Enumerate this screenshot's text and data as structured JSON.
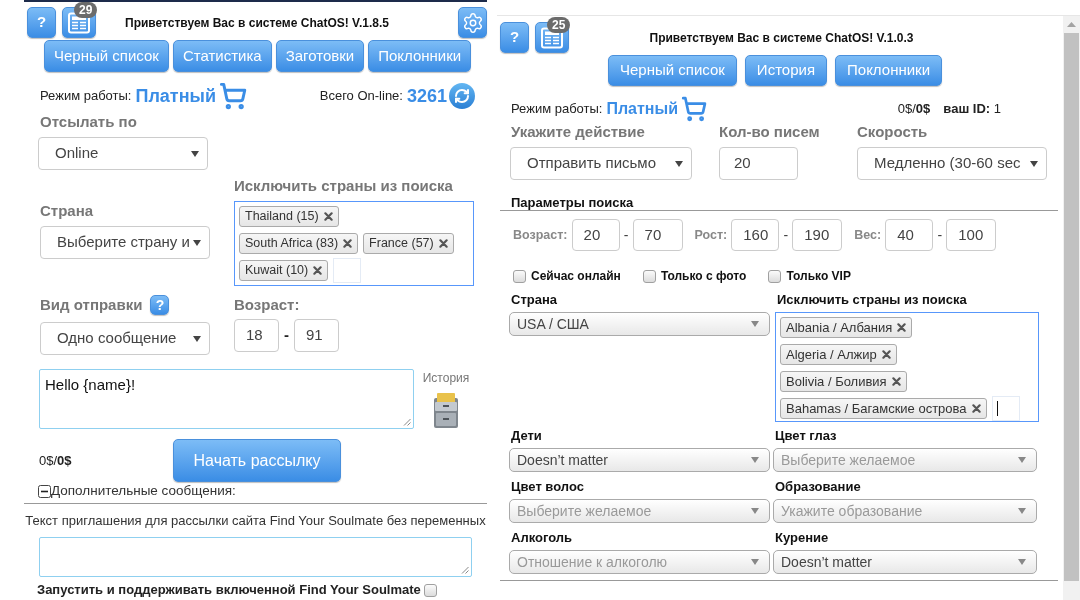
{
  "left_panel": {
    "header": {
      "help": "?",
      "news_count": "29",
      "title": "Приветствуем Вас в системе ChatOS! V.1.8.5"
    },
    "nav_buttons": [
      "Черный список",
      "Статистика",
      "Заготовки",
      "Поклонники"
    ],
    "mode": {
      "label": "Режим работы:",
      "value": "Платный"
    },
    "online": {
      "label": "Всего On-line:",
      "value": "3261"
    },
    "send_by": {
      "label": "Отсылать по",
      "value": "Online"
    },
    "exclude_countries": {
      "label": "Исключить страны из поиска",
      "tag_rows": [
        [
          "Thailand (15)"
        ],
        [
          "South Africa (83)",
          "France (57)"
        ],
        [
          "Kuwait (10)"
        ]
      ]
    },
    "country": {
      "label": "Страна",
      "value": "Выберите страну и"
    },
    "send_type": {
      "label": "Вид отправки",
      "help": "?",
      "value": "Одно сообщение"
    },
    "age": {
      "label": "Возраст:",
      "from": "18",
      "separator": "-",
      "to": "91"
    },
    "message": {
      "value": "Hello {name}!"
    },
    "history": {
      "label": "История"
    },
    "balance": "0$/**0$**",
    "start_button": "Начать рассылку",
    "extra_messages": {
      "label": "Дополнительные сообщения:",
      "expanded": true
    },
    "invite": {
      "label": "Текст приглашения для рассылки сайта Find Your Soulmate без переменных"
    },
    "keep_running": {
      "label": "Запустить и поддерживать включенной Find Your Soulmate",
      "checked": false
    }
  },
  "right_panel": {
    "header": {
      "help": "?",
      "news_count": "25",
      "title": "Приветствуем Вас в системе ChatOS! V.1.0.3"
    },
    "nav_buttons": [
      "Черный список",
      "История",
      "Поклонники"
    ],
    "mode": {
      "label": "Режим работы:",
      "value": "Платный"
    },
    "balance": "0$/**0$**",
    "user_id": "**ваш ID:** 1",
    "action": {
      "label": "Укажите действие",
      "value": "Отправить письмо"
    },
    "letter_count": {
      "label": "Кол-во писем",
      "value": "20"
    },
    "speed": {
      "label": "Скорость",
      "value": "Медленно (30-60 sec"
    },
    "search_params": {
      "title": "Параметры поиска",
      "ranges": [
        {
          "label": "Возраст:",
          "from": "20",
          "separator": "-",
          "to": "70"
        },
        {
          "label": "Рост:",
          "from": "160",
          "separator": "-",
          "to": "190"
        },
        {
          "label": "Вес:",
          "from": "40",
          "separator": "-",
          "to": "100"
        }
      ],
      "filters": [
        {
          "label": "Сейчас онлайн",
          "checked": false
        },
        {
          "label": "Только с фото",
          "checked": false
        },
        {
          "label": "Только VIP",
          "checked": false
        }
      ]
    },
    "country": {
      "label": "Страна",
      "value": "USA / США"
    },
    "exclude_countries": {
      "label": "Исключить страны из поиска",
      "tag_rows": [
        [
          "Albania / Албания"
        ],
        [
          "Algeria / Алжир"
        ],
        [
          "Bolivia / Боливия"
        ],
        [
          "Bahamas / Багамские острова"
        ]
      ]
    },
    "preferences": [
      {
        "label": "Дети",
        "value": "Doesn’t matter"
      },
      {
        "label": "Цвет глаз",
        "placeholder": "Выберите желаемое"
      },
      {
        "label": "Цвет волос",
        "placeholder": "Выберите желаемое"
      },
      {
        "label": "Образование",
        "placeholder": "Укажите образование"
      },
      {
        "label": "Алкоголь",
        "placeholder": "Отношение к алкоголю"
      },
      {
        "label": "Курение",
        "value": "Doesn’t matter"
      }
    ]
  }
}
